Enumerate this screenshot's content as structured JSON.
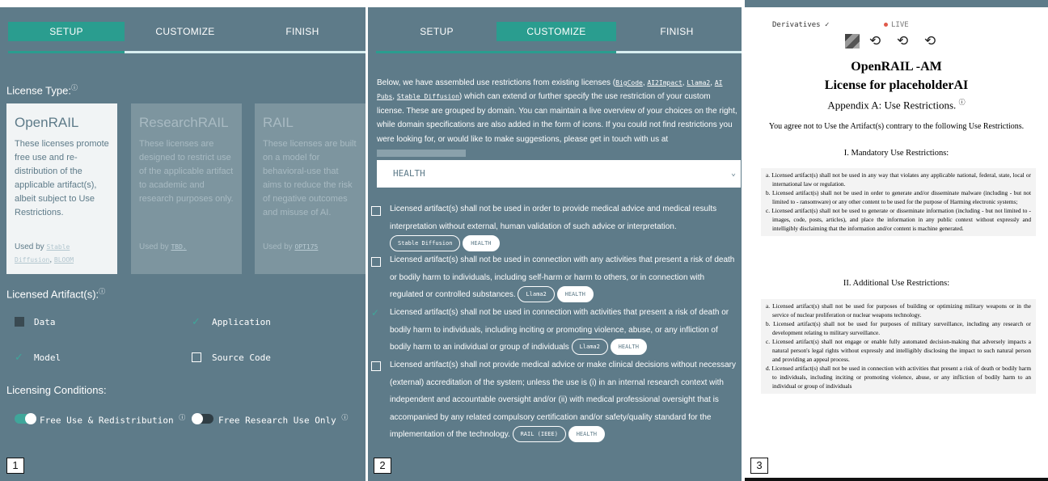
{
  "tabs": {
    "setup": "SETUP",
    "customize": "CUSTOMIZE",
    "finish": "FINISH"
  },
  "panel1": {
    "license_type_label": "License Type:",
    "info_glyph": "ⓘ",
    "cards": [
      {
        "title": "OpenRAIL",
        "desc": "These licenses promote free use and re-distribution of the applicable artifact(s), albeit subject to Use Restrictions.",
        "used_by_prefix": "Used by ",
        "used_by_links": [
          "Stable Diffusion",
          "BLOOM"
        ],
        "separator": ", "
      },
      {
        "title": "ResearchRAIL",
        "desc": "These licenses are designed to restrict use of the applicable artifact to academic and research purposes only.",
        "used_by_prefix": "Used by ",
        "used_by_links": [
          "TBD."
        ]
      },
      {
        "title": "RAIL",
        "desc": "These licenses are built on a model for behavioral-use that aims to reduce the risk of negative outcomes and misuse of AI.",
        "used_by_prefix": "Used by ",
        "used_by_links": [
          "OPT175"
        ]
      }
    ],
    "licensed_artifacts_label": "Licensed Artifact(s):",
    "artifacts": {
      "data": "Data",
      "application": "Application",
      "model": "Model",
      "source_code": "Source Code"
    },
    "licensing_conditions_label": "Licensing Conditions:",
    "conditions": {
      "free_use": "Free Use & Redistribution",
      "free_research": "Free Research Use Only"
    },
    "marker": "1"
  },
  "panel2": {
    "intro_a": "Below, we have assembled use restrictions from existing licenses (",
    "intro_links": [
      "BigCode",
      "AI2Impact",
      "Llama2",
      "AI Pubs",
      "Stable Diffusion"
    ],
    "intro_b": ") which can extend or further specify the use restriction of your custom license. These are grouped by domain. You can maintain a live overview of your choices on the right, while domain specifications are also added in the form of icons. If you could not find restrictions you were looking for, or would like to make suggestions, please get in touch with us at",
    "domain_select": "HEALTH",
    "restrictions": [
      {
        "text": "Licensed artifact(s) shall not be used in order to provide medical advice and medical results interpretation without external, human validation of such advice or interpretation.",
        "source": "Stable Diffusion",
        "tag": "HEALTH"
      },
      {
        "text": "Licensed artifact(s) shall not be used in connection with any activities that present a risk of death or bodily harm to individuals, including self-harm or harm to others, or in connection with regulated or controlled substances.",
        "source": "Llama2",
        "tag": "HEALTH"
      },
      {
        "text": "Licensed artifact(s) shall not be used in connection with activities that present a risk of death or bodily harm to individuals, including inciting or promoting violence, abuse, or any infliction of bodily harm to an individual or group of individuals",
        "source": "Llama2",
        "tag": "HEALTH"
      },
      {
        "text": "Licensed artifact(s) shall not provide medical advice or make clinical decisions without necessary (external) accreditation of the system; unless the use is (i) in an internal research context with independent and accountable oversight and/or (ii) with medical professional oversight that is accompanied by any related compulsory certification and/or safety/quality standard for the implementation of the technology.",
        "source": "RAIL (IEEE)",
        "tag": "HEALTH"
      }
    ],
    "marker": "2"
  },
  "panel3": {
    "derivatives": "Derivatives ✓",
    "live": "LIVE",
    "title1": "OpenRAIL -AM",
    "title2": "License for placeholderAI",
    "appendix": "Appendix A: Use Restrictions.",
    "agree": "You agree not to Use the Artifact(s) contrary to the following Use Restrictions.",
    "mandatory_heading": "I. Mandatory Use Restrictions:",
    "mandatory": [
      "a. Licensed artifact(s) shall not be used in any way that violates any applicable national, federal, state, local or international law or regulation.",
      "b. Licensed artifact(s) shall not be used in order to generate and/or disseminate malware (including - but not limited to - ransomware) or any other content to be used for the purpose of Harming electronic systems;",
      "c. Licensed artifact(s) shall not be used to generate or disseminate information (including - but not limited to - images, code, posts, articles), and place the information in any public context without expressly and intelligibly disclaiming that the information and/or content is machine generated."
    ],
    "additional_heading": "II. Additional Use Restrictions:",
    "additional": [
      "a. Licensed artifact(s) shall not be used for purposes of building or optimizing military weapons or in the service of nuclear proliferation or nuclear weapons technology.",
      "b. Licensed artifact(s) shall not be used for purposes of military surveillance, including any research or development relating to military surveillance.",
      "c. Licensed artifact(s) shall not engage or enable fully automated decision-making that adversely impacts a natural person's legal rights without expressly and intelligibly disclosing the impact to such natural person and providing an appeal process.",
      "d. Licensed artifact(s) shall not be used in connection with activities that present a risk of death or bodily harm to individuals, including inciting or promoting violence, abuse, or any infliction of bodily harm to an individual or group of individuals"
    ],
    "marker": "3"
  },
  "colors": {
    "panel_bg": "#5e7b89",
    "accent": "#2a9d8f",
    "live": "#e05a4a"
  }
}
